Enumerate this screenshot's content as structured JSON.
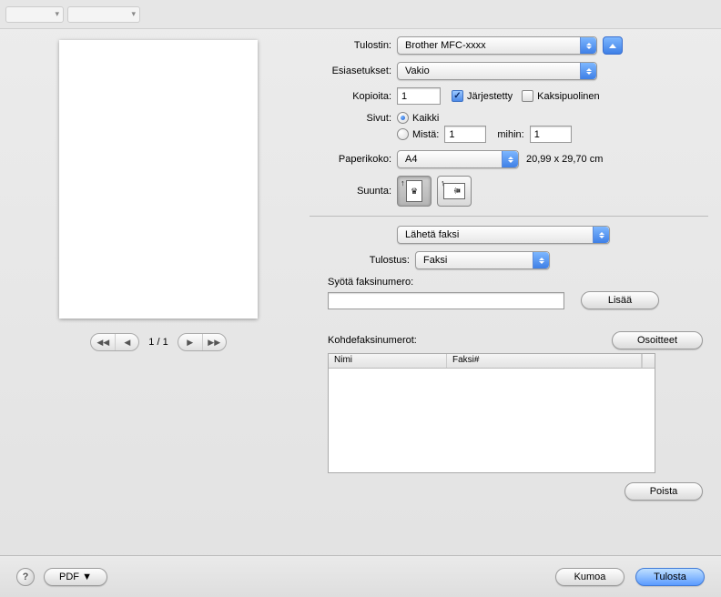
{
  "labels": {
    "printer": "Tulostin:",
    "presets": "Esiasetukset:",
    "copies": "Kopioita:",
    "collated": "Järjestetty",
    "two_sided": "Kaksipuolinen",
    "pages": "Sivut:",
    "pages_all": "Kaikki",
    "pages_from": "Mistä:",
    "pages_to": "mihin:",
    "paper_size": "Paperikoko:",
    "orientation": "Suunta:",
    "section": "Lähetä faksi",
    "output": "Tulostus:",
    "enter_fax": "Syötä faksinumero:",
    "dest_fax": "Kohdefaksinumerot:",
    "th_name": "Nimi",
    "th_fax": "Faksi#",
    "add": "Lisää",
    "addresses": "Osoitteet",
    "remove": "Poista",
    "cancel": "Kumoa",
    "print": "Tulosta",
    "pdf": "PDF ▼",
    "help": "?",
    "page_indicator": "1 / 1"
  },
  "values": {
    "printer": "Brother MFC-xxxx",
    "preset": "Vakio",
    "copies": "1",
    "collated": true,
    "two_sided": false,
    "pages_mode": "all",
    "pages_from": "1",
    "pages_to": "1",
    "paper_size": "A4",
    "paper_dims": "20,99 x 29,70 cm",
    "orientation": "portrait",
    "output": "Faksi",
    "fax_input": ""
  }
}
